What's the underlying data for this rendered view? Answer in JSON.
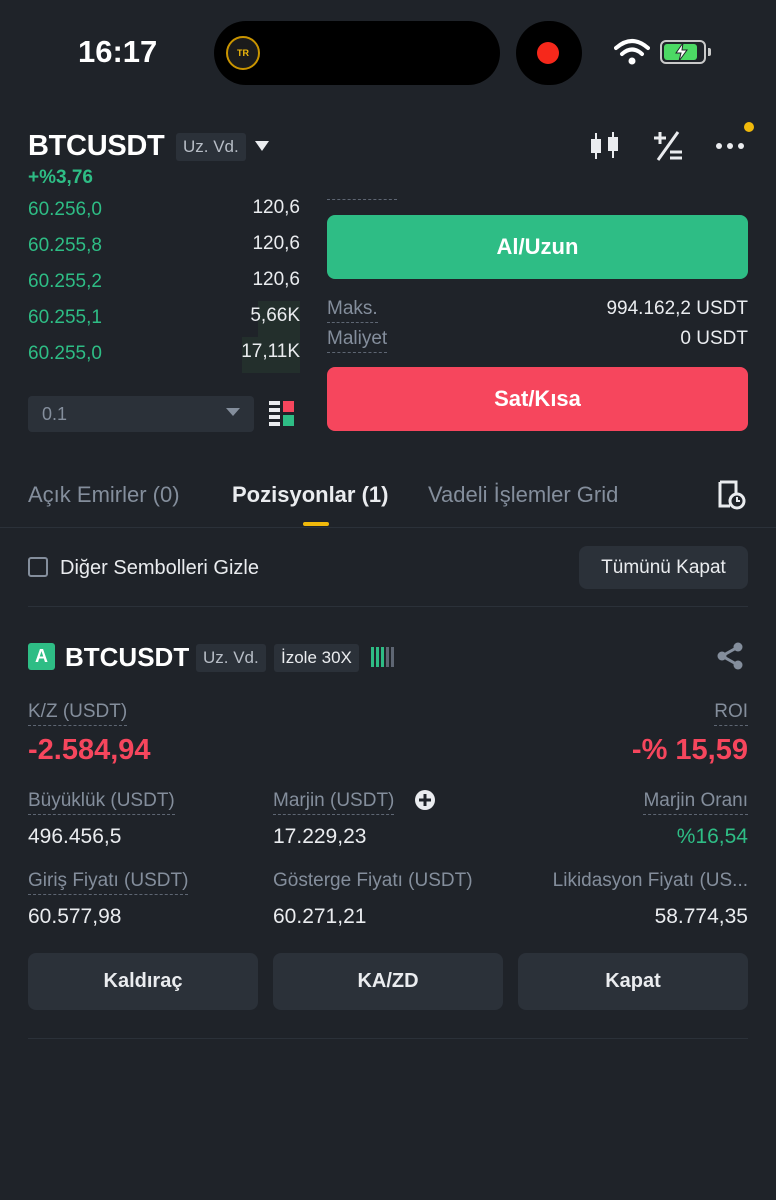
{
  "status_bar": {
    "time": "16:17",
    "island_logo_text": "TR"
  },
  "header": {
    "symbol": "BTCUSDT",
    "contract_tag": "Uz. Vd.",
    "change_pct": "+%3,76"
  },
  "order_book": {
    "rows": [
      {
        "price": "60.256,0",
        "qty": "120,6"
      },
      {
        "price": "60.255,8",
        "qty": "120,6"
      },
      {
        "price": "60.255,2",
        "qty": "120,6"
      },
      {
        "price": "60.255,1",
        "qty": "5,66K"
      },
      {
        "price": "60.255,0",
        "qty": "17,11K"
      }
    ],
    "precision_value": "0.1"
  },
  "trade": {
    "buy_label": "Al/Uzun",
    "sell_label": "Sat/Kısa",
    "max_label": "Maks.",
    "max_value": "994.162,2 USDT",
    "cost_label": "Maliyet",
    "cost_value": "0 USDT"
  },
  "tabs": [
    {
      "label": "Açık Emirler (0)"
    },
    {
      "label": "Pozisyonlar (1)"
    },
    {
      "label": "Vadeli İşlemler Grid"
    }
  ],
  "filter": {
    "hide_label": "Diğer Sembolleri Gizle",
    "close_all_label": "Tümünü Kapat"
  },
  "position": {
    "side_badge": "A",
    "symbol": "BTCUSDT",
    "contract_tag": "Uz. Vd.",
    "margin_tag": "İzole 30X",
    "pnl_label": "K/Z (USDT)",
    "pnl_value": "-2.584,94",
    "roi_label": "ROI",
    "roi_value": "-% 15,59",
    "size_label": "Büyüklük (USDT)",
    "size_value": "496.456,5",
    "margin_label": "Marjin (USDT)",
    "margin_value": "17.229,23",
    "margin_ratio_label": "Marjin Oranı",
    "margin_ratio_value": "%16,54",
    "entry_label": "Giriş Fiyatı (USDT)",
    "entry_value": "60.577,98",
    "mark_label": "Gösterge Fiyatı (USDT)",
    "mark_value": "60.271,21",
    "liq_label": "Likidasyon Fiyatı (US...",
    "liq_value": "58.774,35",
    "buttons": {
      "leverage": "Kaldıraç",
      "tpsl": "KA/ZD",
      "close": "Kapat"
    }
  },
  "colors": {
    "green": "#2ebd85",
    "red": "#f6465d",
    "accent": "#f0b90b"
  }
}
